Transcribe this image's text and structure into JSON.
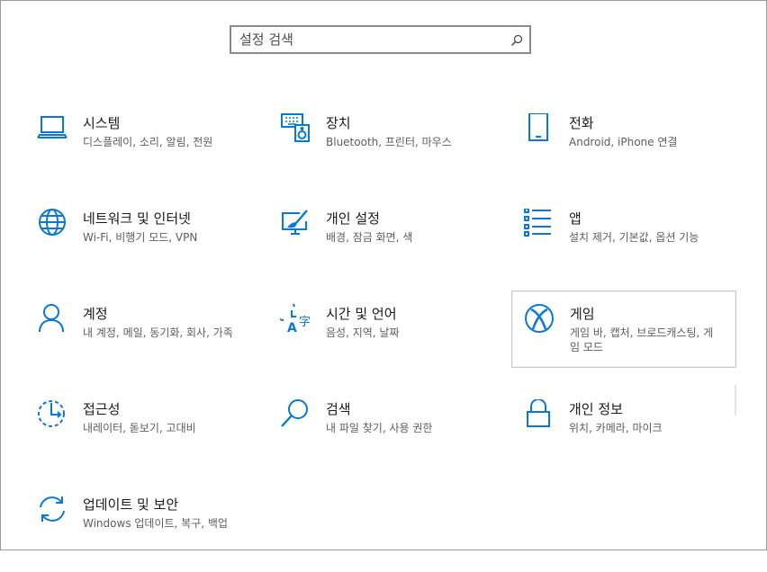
{
  "search": {
    "placeholder": "설정 검색",
    "icon": "search-icon"
  },
  "accent_color": "#0a78d4",
  "categories": [
    {
      "title": "시스템",
      "desc": "디스플레이, 소리, 알림, 전원",
      "icon": "laptop-icon"
    },
    {
      "title": "장치",
      "desc": "Bluetooth, 프린터, 마우스",
      "icon": "devices-icon"
    },
    {
      "title": "전화",
      "desc": "Android, iPhone 연결",
      "icon": "phone-icon"
    },
    {
      "title": "네트워크 및 인터넷",
      "desc": "Wi-Fi, 비행기 모드, VPN",
      "icon": "globe-icon"
    },
    {
      "title": "개인 설정",
      "desc": "배경, 잠금 화면, 색",
      "icon": "personalization-icon"
    },
    {
      "title": "앱",
      "desc": "설치 제거, 기본값, 옵션 기능",
      "icon": "apps-list-icon"
    },
    {
      "title": "계정",
      "desc": "내 계정, 메일, 동기화, 회사, 가족",
      "icon": "person-icon"
    },
    {
      "title": "시간 및 언어",
      "desc": "음성, 지역, 날짜",
      "icon": "time-language-icon"
    },
    {
      "title": "게임",
      "desc": "게임 바, 캡처, 브로드캐스팅, 게임 모드",
      "icon": "xbox-icon"
    },
    {
      "title": "접근성",
      "desc": "내레이터, 돋보기, 고대비",
      "icon": "ease-of-access-icon"
    },
    {
      "title": "검색",
      "desc": "내 파일 찾기, 사용 권한",
      "icon": "search-category-icon"
    },
    {
      "title": "개인 정보",
      "desc": "위치, 카메라, 마이크",
      "icon": "lock-icon"
    },
    {
      "title": "업데이트 및 보안",
      "desc": "Windows 업데이트, 복구, 백업",
      "icon": "update-icon"
    }
  ]
}
